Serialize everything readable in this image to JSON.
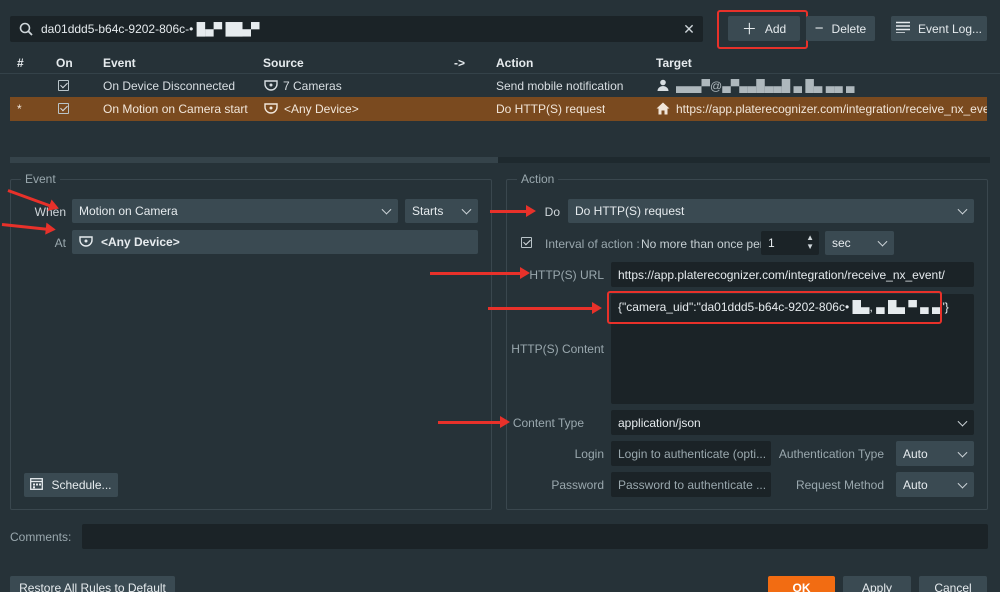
{
  "search": {
    "value": "da01ddd5-b64c-9202-806c-• █▄▀ ██▄▀"
  },
  "toolbar": {
    "add_label": "Add",
    "delete_label": "Delete",
    "event_log_label": "Event Log..."
  },
  "table": {
    "headers": {
      "num": "#",
      "on": "On",
      "event": "Event",
      "source": "Source",
      "arrow": "->",
      "action": "Action",
      "target": "Target"
    },
    "rows": [
      {
        "num": "",
        "event": "On Device Disconnected",
        "source": "7 Cameras",
        "action": "Send mobile notification",
        "target": "▄▄▄▀@▄▀▄▄█▄▄█ ▄ █▄ ▄▄ ▄ ▄"
      },
      {
        "num": "*",
        "event": "On Motion on Camera start",
        "source": "<Any Device>",
        "action": "Do HTTP(S) request",
        "target": "https://app.platerecognizer.com/integration/receive_nx_event/"
      }
    ]
  },
  "event_panel": {
    "title": "Event",
    "when_label": "When",
    "when_value": "Motion on Camera",
    "starts_value": "Starts",
    "at_label": "At",
    "at_value": "<Any Device>",
    "schedule_label": "Schedule..."
  },
  "action_panel": {
    "title": "Action",
    "do_label": "Do",
    "do_value": "Do HTTP(S) request",
    "interval_label": "Interval of action :",
    "interval_text": "No more than once per",
    "interval_value": "1",
    "interval_unit": "sec",
    "url_label": "HTTP(S) URL",
    "url_value": "https://app.platerecognizer.com/integration/receive_nx_event/",
    "content_label": "HTTP(S) Content",
    "content_value": "{\"camera_uid\":\"da01ddd5-b64c-9202-806c• █▄, ▄ █▄ ▀ ▄ ▄\"}",
    "content_type_label": "Content Type",
    "content_type_value": "application/json",
    "login_label": "Login",
    "login_placeholder": "Login to authenticate (opti...",
    "auth_type_label": "Authentication Type",
    "auth_type_value": "Auto",
    "password_label": "Password",
    "password_placeholder": "Password to authenticate ...",
    "request_method_label": "Request Method",
    "request_method_value": "Auto"
  },
  "comments": {
    "label": "Comments:"
  },
  "footer": {
    "restore_label": "Restore All Rules to Default",
    "ok_label": "OK",
    "apply_label": "Apply",
    "cancel_label": "Cancel"
  },
  "colors": {
    "accent_orange": "#f26c12",
    "highlight_red": "#e8312a",
    "selected_row": "#7a4a1f"
  }
}
